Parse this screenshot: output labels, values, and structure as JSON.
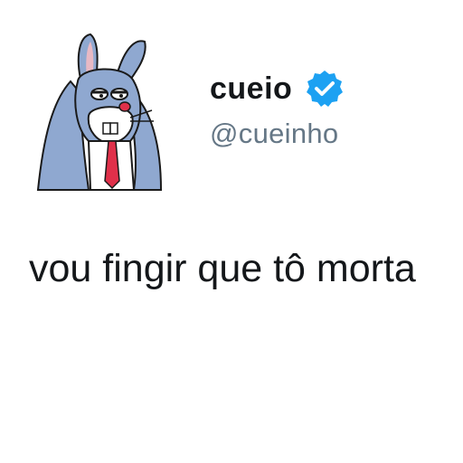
{
  "profile": {
    "display_name": "cueio",
    "handle": "@cueinho",
    "verified": true,
    "avatar_icon": "bugs-bunny-meme-avatar"
  },
  "tweet": {
    "text": "vou fingir que tô morta"
  },
  "colors": {
    "verified_badge": "#1da1f2",
    "name": "#14171a",
    "handle": "#657786",
    "avatar_fur": "#8fa8d0"
  }
}
